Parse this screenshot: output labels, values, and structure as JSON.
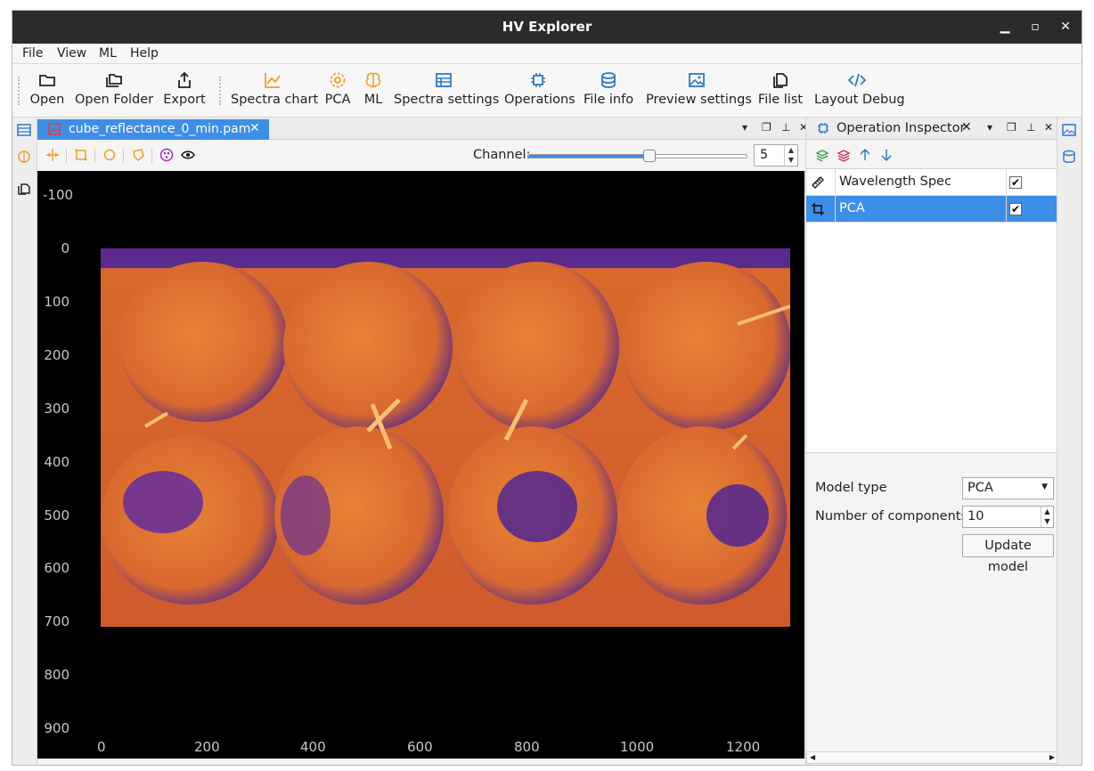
{
  "window": {
    "title": "HV Explorer"
  },
  "menu": [
    "File",
    "View",
    "ML",
    "Help"
  ],
  "toolbar": [
    {
      "label": "Open",
      "icon": "folder-open-icon"
    },
    {
      "label": "Open Folder",
      "icon": "folders-icon"
    },
    {
      "label": "Export",
      "icon": "share-icon"
    },
    {
      "label": "Spectra chart",
      "icon": "line-chart-icon"
    },
    {
      "label": "PCA",
      "icon": "gear-icon"
    },
    {
      "label": "ML",
      "icon": "brain-icon"
    },
    {
      "label": "Spectra settings",
      "icon": "table-settings-icon"
    },
    {
      "label": "Operations",
      "icon": "cpu-icon"
    },
    {
      "label": "File info",
      "icon": "database-icon"
    },
    {
      "label": "Preview settings",
      "icon": "image-icon"
    },
    {
      "label": "File list",
      "icon": "files-icon"
    },
    {
      "label": "Layout Debug",
      "icon": "code-icon"
    }
  ],
  "image_panel": {
    "tab_label": "cube_reflectance_0_min.pam",
    "channel_label": "Channel:",
    "channel_value": "5",
    "channel_slider_fraction": 0.55,
    "y_ticks": [
      "-100",
      "0",
      "100",
      "200",
      "300",
      "400",
      "500",
      "600",
      "700",
      "800",
      "900"
    ],
    "x_ticks": [
      "0",
      "200",
      "400",
      "600",
      "800",
      "1000",
      "1200"
    ]
  },
  "operation_inspector": {
    "title": "Operation Inspector",
    "operations": [
      {
        "name": "Wavelength Spec",
        "enabled": "✔",
        "selected": false
      },
      {
        "name": "PCA",
        "enabled": "✔",
        "selected": true
      }
    ],
    "model_type_label": "Model type",
    "model_type_value": "PCA",
    "components_label": "Number of components",
    "components_value": "10",
    "update_button": "Update model"
  },
  "colors": {
    "accent": "#3d8ee6",
    "toolbar_icon_orange": "#f0a020",
    "toolbar_icon_blue": "#2f78c8",
    "titlebar": "#2b2b2b"
  }
}
